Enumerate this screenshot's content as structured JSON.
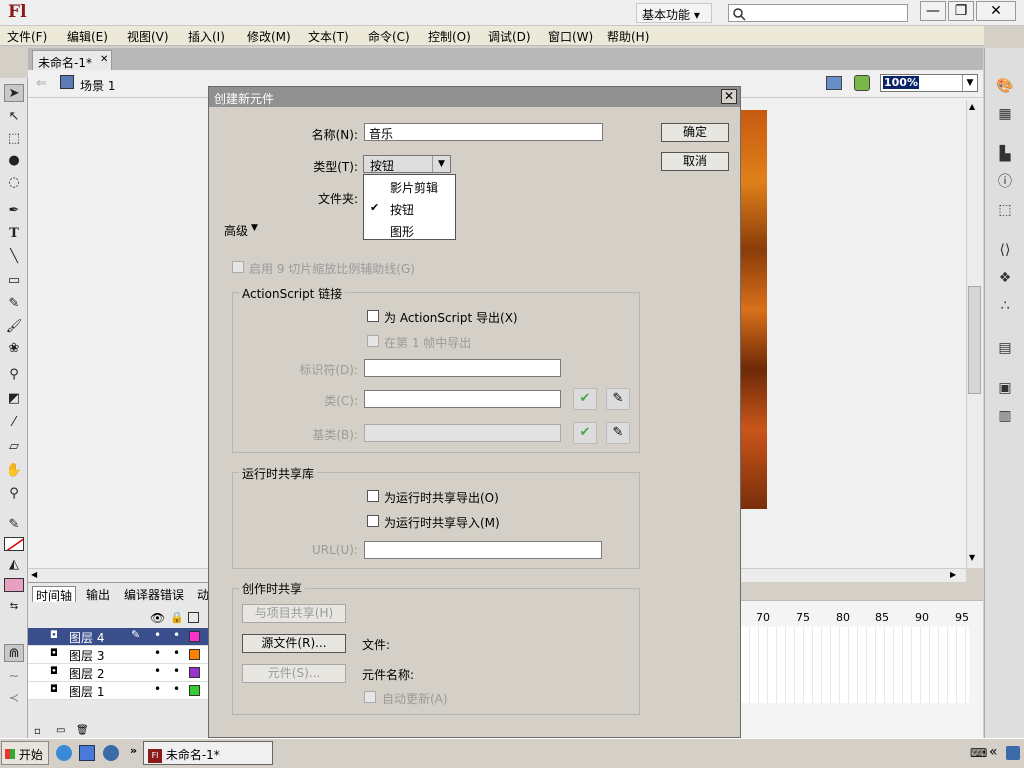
{
  "app": {
    "logo": "Fl",
    "workspace": "基本功能 ▾"
  },
  "menu": [
    "文件(F)",
    "编辑(E)",
    "视图(V)",
    "插入(I)",
    "修改(M)",
    "文本(T)",
    "命令(C)",
    "控制(O)",
    "调试(D)",
    "窗口(W)",
    "帮助(H)"
  ],
  "document": {
    "tab": "未命名-1*",
    "scene": "场景 1",
    "zoom": "100%"
  },
  "dialog": {
    "title": "创建新元件",
    "name_label": "名称(N):",
    "name_value": "音乐",
    "type_label": "类型(T):",
    "type_value": "按钮",
    "folder_label": "文件夹:",
    "type_options": [
      "影片剪辑",
      "按钮",
      "图形"
    ],
    "advanced_label": "高级",
    "ok": "确定",
    "cancel": "取消",
    "enable_9slice": "启用 9 切片缩放比例辅助线(G)",
    "as_group": "ActionScript 链接",
    "export_as": "为 ActionScript 导出(X)",
    "export_frame1": "在第 1 帧中导出",
    "identifier_label": "标识符(D):",
    "class_label": "类(C):",
    "base_class_label": "基类(B):",
    "runtime_group": "运行时共享库",
    "runtime_export": "为运行时共享导出(O)",
    "runtime_import": "为运行时共享导入(M)",
    "url_label": "URL(U):",
    "authortime_group": "创作时共享",
    "share_with_project": "与项目共享(H)",
    "source_file_btn": "源文件(R)...",
    "file_label": "文件:",
    "symbol_btn": "元件(S)...",
    "symbol_name_label": "元件名称:",
    "auto_update": "自动更新(A)"
  },
  "timeline": {
    "tabs": [
      "时间轴",
      "输出",
      "编译器错误",
      "动"
    ],
    "layers": [
      {
        "name": "图层 4",
        "color": "#ff33cc",
        "selected": true
      },
      {
        "name": "图层 3",
        "color": "#ff8000",
        "selected": false
      },
      {
        "name": "图层 2",
        "color": "#9933cc",
        "selected": false
      },
      {
        "name": "图层 1",
        "color": "#33cc33",
        "selected": false
      }
    ],
    "frame_numbers": [
      "70",
      "75",
      "80",
      "85",
      "90",
      "95"
    ]
  },
  "taskbar": {
    "start": "开始",
    "task": "未命名-1*"
  }
}
